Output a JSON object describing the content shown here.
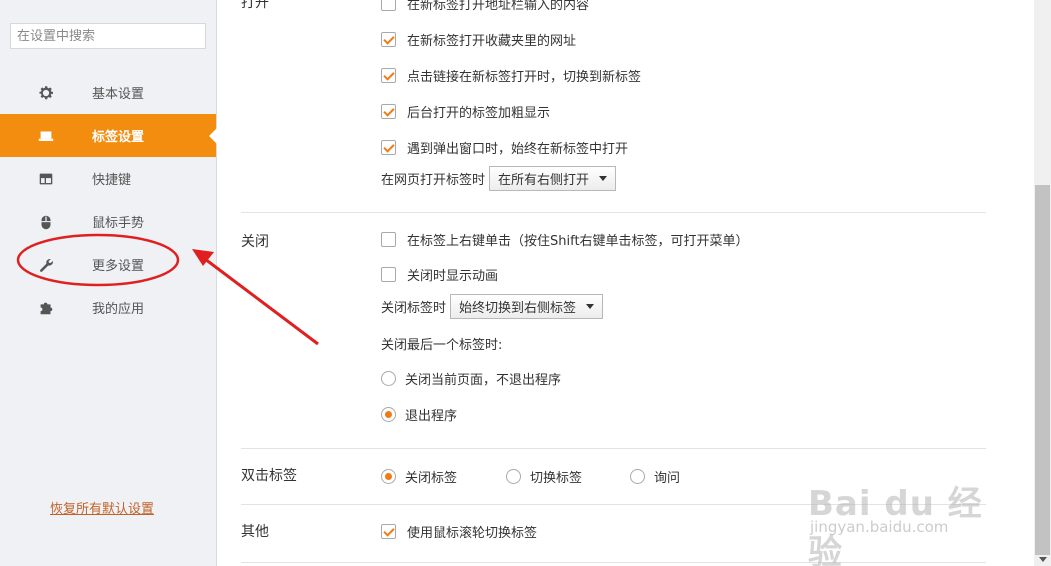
{
  "search": {
    "placeholder": "在设置中搜索"
  },
  "sidebar": {
    "items": [
      {
        "label": "基本设置",
        "icon": "gear-icon"
      },
      {
        "label": "标签设置",
        "icon": "laptop-icon",
        "active": true
      },
      {
        "label": "快捷键",
        "icon": "layout-icon"
      },
      {
        "label": "鼠标手势",
        "icon": "mouse-icon"
      },
      {
        "label": "更多设置",
        "icon": "wrench-icon"
      },
      {
        "label": "我的应用",
        "icon": "puzzle-icon"
      }
    ],
    "reset_label": "恢复所有默认设置"
  },
  "sections": {
    "open": {
      "title": "打开",
      "options": [
        {
          "label": "在新标签打开地址栏输入的内容",
          "checked": false
        },
        {
          "label": "在新标签打开收藏夹里的网址",
          "checked": true
        },
        {
          "label": "点击链接在新标签打开时，切换到新标签",
          "checked": true
        },
        {
          "label": "后台打开的标签加粗显示",
          "checked": true
        },
        {
          "label": "遇到弹出窗口时，始终在新标签中打开",
          "checked": true
        }
      ],
      "select_label": "在网页打开标签时",
      "select_value": "在所有右侧打开"
    },
    "close": {
      "title": "关闭",
      "options": [
        {
          "label": "在标签上右键单击（按住Shift右键单击标签，可打开菜单）",
          "checked": false
        },
        {
          "label": "关闭时显示动画",
          "checked": false
        }
      ],
      "select_label": "关闭标签时",
      "select_value": "始终切换到右侧标签",
      "last_tab_label": "关闭最后一个标签时:",
      "radios": [
        {
          "label": "关闭当前页面，不退出程序",
          "checked": false
        },
        {
          "label": "退出程序",
          "checked": true
        }
      ]
    },
    "dblclick": {
      "title": "双击标签",
      "radios": [
        {
          "label": "关闭标签",
          "checked": true
        },
        {
          "label": "切换标签",
          "checked": false
        },
        {
          "label": "询问",
          "checked": false
        }
      ]
    },
    "other": {
      "title": "其他",
      "options": [
        {
          "label": "使用鼠标滚轮切换标签",
          "checked": true
        }
      ]
    }
  },
  "watermark": {
    "logo": "Bai du 经验",
    "url": "jingyan.baidu.com"
  },
  "colors": {
    "accent": "#f28d0f",
    "annotation": "#e02020",
    "check": "#f07b14"
  }
}
